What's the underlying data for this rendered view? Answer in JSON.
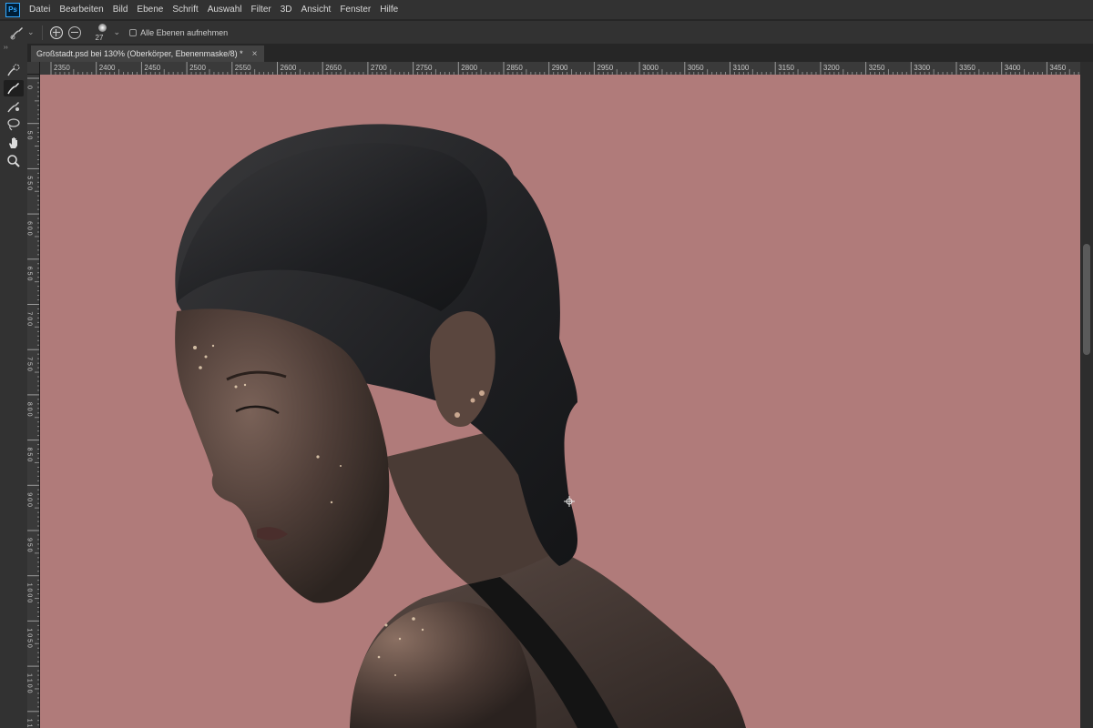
{
  "menu": {
    "app_icon": "Ps",
    "items": [
      "Datei",
      "Bearbeiten",
      "Bild",
      "Ebene",
      "Schrift",
      "Auswahl",
      "Filter",
      "3D",
      "Ansicht",
      "Fenster",
      "Hilfe"
    ]
  },
  "options": {
    "tool_icon": "refine-edge-brush-icon",
    "brush_size": "27",
    "sample_all_layers_label": "Alle Ebenen aufnehmen"
  },
  "document": {
    "tab_title": "Großstadt.psd bei 130% (Oberkörper, Ebenenmaske/8) *",
    "close_glyph": "×"
  },
  "ruler": {
    "top_ticks": [
      "2350",
      "2400",
      "2450",
      "2500",
      "2550",
      "2600",
      "2650",
      "2700",
      "2750",
      "2800",
      "2850",
      "2900",
      "2950",
      "3000",
      "3050",
      "3100",
      "3150",
      "3200",
      "3250",
      "3300",
      "3350",
      "3400",
      "3450"
    ],
    "left_ticks": [
      "0",
      "5 0",
      "5 5 0",
      "6 0 0",
      "6 5 0",
      "7 0 0",
      "7 5 0",
      "8 0 0",
      "8 5 0",
      "9 0 0",
      "9 5 0",
      "1 0 0 0",
      "1 0 5 0",
      "1 1 0 0",
      "1 1 5 0"
    ]
  },
  "tools": [
    {
      "name": "quick-selection-icon",
      "active": false
    },
    {
      "name": "refine-edge-brush-icon",
      "active": true
    },
    {
      "name": "brush-icon",
      "active": false
    },
    {
      "name": "lasso-icon",
      "active": false
    },
    {
      "name": "hand-icon",
      "active": false
    },
    {
      "name": "zoom-icon",
      "active": false
    }
  ],
  "colors": {
    "canvas_bg": "#b07b7a",
    "ui_dark": "#323232",
    "accent": "#31a8ff"
  }
}
